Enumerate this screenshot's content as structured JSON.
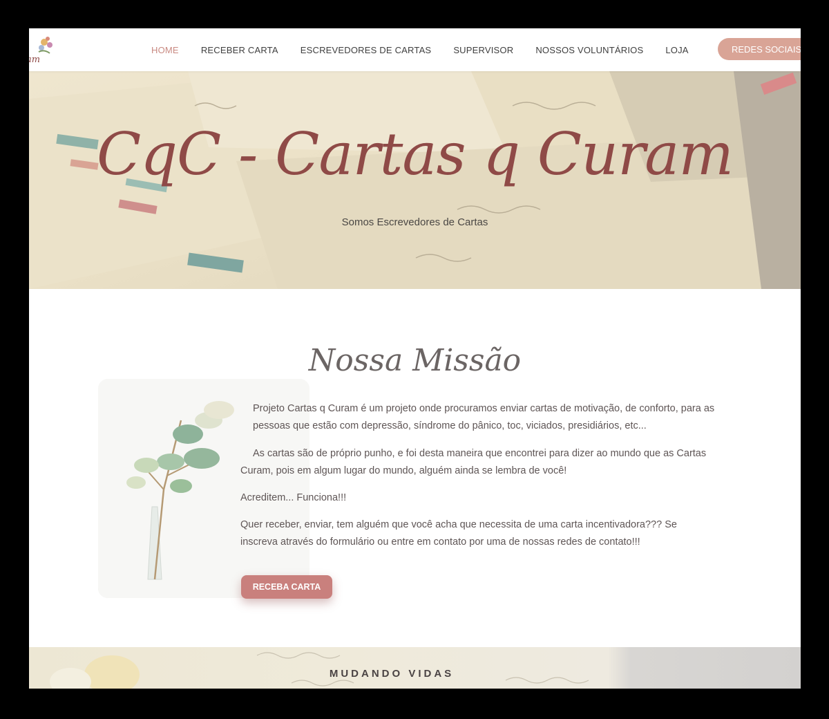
{
  "brand": {
    "logo_text": "Cartas q Curam"
  },
  "nav": {
    "items": [
      {
        "label": "HOME",
        "active": true
      },
      {
        "label": "RECEBER CARTA",
        "active": false
      },
      {
        "label": "ESCREVEDORES DE CARTAS",
        "active": false
      },
      {
        "label": "SUPERVISOR",
        "active": false
      },
      {
        "label": "NOSSOS VOLUNTÁRIOS",
        "active": false
      },
      {
        "label": "LOJA",
        "active": false
      }
    ],
    "cta_label": "REDES SOCIAIS"
  },
  "hero": {
    "title": "CqC - Cartas q Curam",
    "subtitle": "Somos Escrevedores de Cartas"
  },
  "mission": {
    "title": "Nossa Missão",
    "paragraphs": [
      "Projeto Cartas q Curam é um projeto onde procuramos enviar cartas de motivação, de conforto, para as pessoas que estão com depressão, síndrome do pânico, toc, viciados, presidiários, etc...",
      "As cartas são de próprio punho, e foi desta maneira que encontrei para dizer ao mundo que as Cartas Curam, pois em algum lugar do mundo, alguém ainda se lembra de você!",
      "Acreditem... Funciona!!!",
      "Quer receber, enviar, tem alguém que você acha que necessita de uma carta incentivadora??? Se inscreva através do formulário ou entre em contato por uma de nossas redes de contato!!!"
    ],
    "button_label": "RECEBA CARTA"
  },
  "band": {
    "title": "MUDANDO VIDAS"
  },
  "colors": {
    "accent": "#c98a82",
    "cta": "#d9a496",
    "button": "#c9807d",
    "hero_title": "#8f4a47"
  },
  "icons": {
    "logo": "flower-bouquet-logo-icon"
  }
}
